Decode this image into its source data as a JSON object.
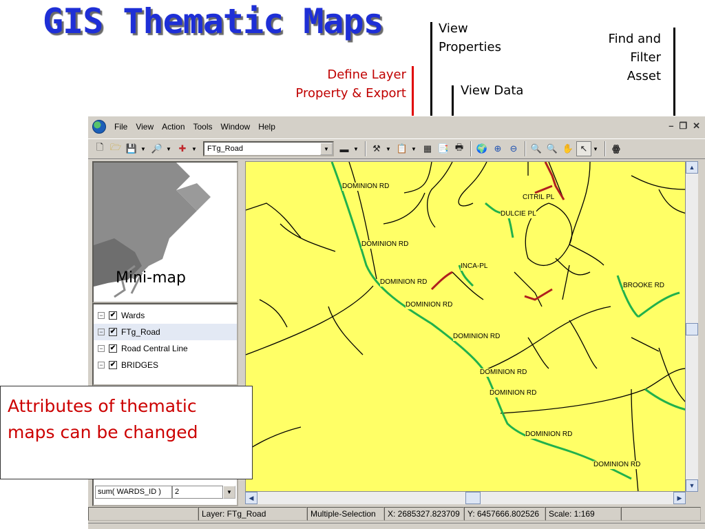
{
  "slide": {
    "title": "GIS Thematic Maps",
    "annotations": {
      "view_properties": "View\nProperties",
      "find_filter": "Find and\nFilter\nAsset",
      "define_layer": "Define Layer\nProperty & Export",
      "view_data": "View Data",
      "mini_map": "Mini-map",
      "callout": "Attributes of thematic maps can be changed"
    }
  },
  "menubar": {
    "items": [
      "File",
      "View",
      "Action",
      "Tools",
      "Window",
      "Help"
    ]
  },
  "toolbar": {
    "layer_select": "FTg_Road"
  },
  "layers": [
    {
      "name": "Wards",
      "checked": true,
      "selected": false
    },
    {
      "name": "FTg_Road",
      "checked": true,
      "selected": true
    },
    {
      "name": "Road Central Line",
      "checked": true,
      "selected": false
    },
    {
      "name": "BRIDGES",
      "checked": true,
      "selected": false
    }
  ],
  "attributes": {
    "sum_expr": "sum( WARDS_ID )",
    "sum_value": "2"
  },
  "map": {
    "road_labels": [
      "DOMINION RD",
      "DOMINION RD",
      "CITRIL PL",
      "DULCIE PL",
      "INCA-PL",
      "DOMINION RD",
      "DOMINION RD",
      "BROOKE RD",
      "DOMINION RD",
      "DOMINION RD",
      "DOMINION RD",
      "DOMINION RD",
      "DOMINION RD"
    ],
    "colors": {
      "background": "#ffff66",
      "road": "#000000",
      "main_road": "#22b14c",
      "highlight": "#b01f1f"
    }
  },
  "status": {
    "layer": "Layer: FTg_Road",
    "mode": "Multiple-Selection",
    "x": "X:  2685327.823709",
    "y": "Y:  6457666.802526",
    "scale": "Scale: 1:169"
  }
}
